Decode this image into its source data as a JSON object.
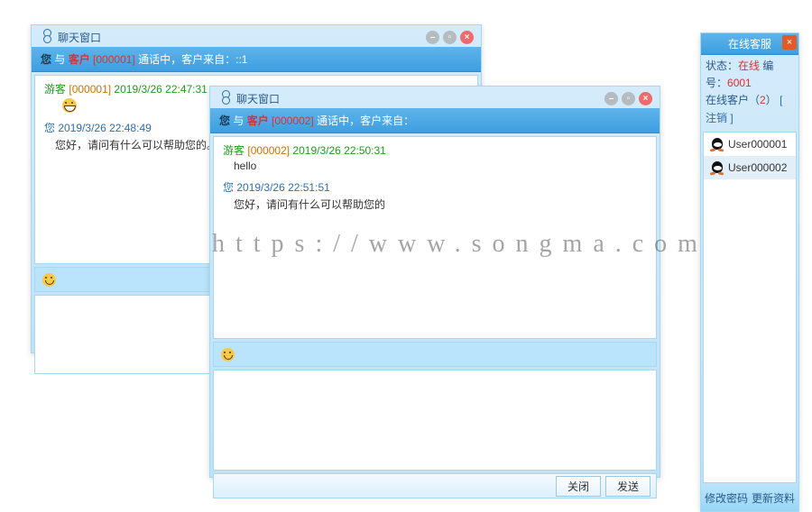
{
  "wm": "https://www.songma.com",
  "win_title": "聊天窗口",
  "hdr": {
    "you": "您",
    "with": " 与 ",
    "cust": "客户",
    "talk": " 通话中，客户来自："
  },
  "w1": {
    "cid": "[000001]",
    "from": "::1",
    "msgs": [
      {
        "who": "guest",
        "name": "游客",
        "id": "[000001]",
        "ts": "2019/3/26 22:47:31",
        "body": ""
      },
      {
        "who": "me",
        "name": "您",
        "ts": "2019/3/26 22:48:49",
        "body": "您好，请问有什么可以帮助您的。"
      }
    ]
  },
  "w2": {
    "cid": "[000002]",
    "from": "",
    "btn_close": "关闭",
    "btn_send": "发送",
    "msgs": [
      {
        "who": "guest",
        "name": "游客",
        "id": "[000002]",
        "ts": "2019/3/26 22:50:31",
        "body": "hello"
      },
      {
        "who": "me",
        "name": "您",
        "ts": "2019/3/26 22:51:51",
        "body": "您好，请问有什么可以帮助您的"
      }
    ]
  },
  "panel": {
    "title": "在线客服",
    "status_l": "状态：",
    "status": "在线",
    "code_l": "编号：",
    "code": "6001",
    "online_l": "在线客户（",
    "count": "2",
    "online_r": "）",
    "logout": "[ 注销 ]",
    "users": [
      {
        "name": "User000001",
        "sel": false
      },
      {
        "name": "User000002",
        "sel": true
      }
    ],
    "pw": "修改密码",
    "upd": "更新资料"
  }
}
